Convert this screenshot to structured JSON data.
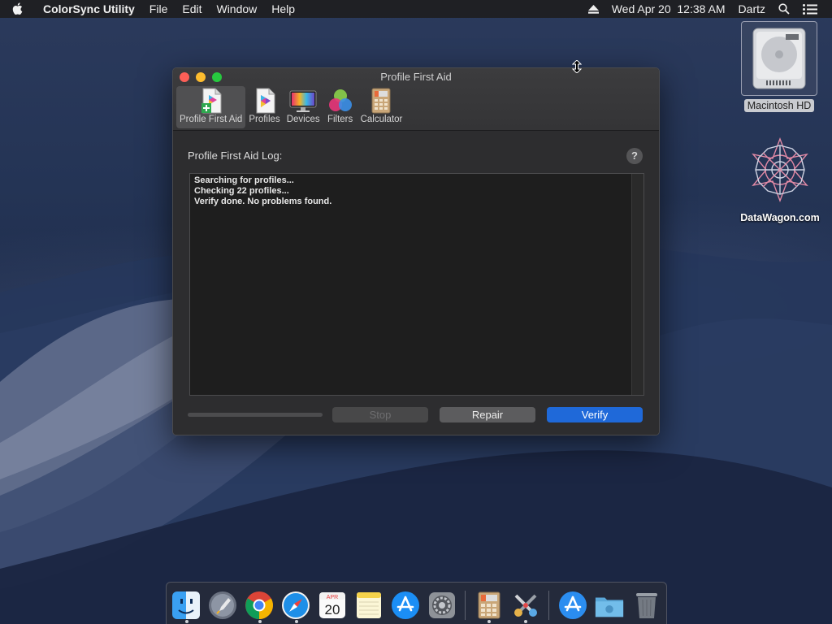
{
  "menubar": {
    "app_name": "ColorSync Utility",
    "menus": [
      "File",
      "Edit",
      "Window",
      "Help"
    ],
    "datetime": "Wed Apr 20  12:38 AM",
    "user": "Dartz"
  },
  "desktop": {
    "icons": [
      {
        "label": "Macintosh HD",
        "icon": "hard-drive-icon"
      },
      {
        "label": "DataWagon.com",
        "icon": "datawagon-logo-icon"
      }
    ]
  },
  "window": {
    "title": "Profile First Aid",
    "toolbar": [
      {
        "label": "Profile First Aid",
        "icon": "first-aid-icon",
        "active": true
      },
      {
        "label": "Profiles",
        "icon": "profiles-icon",
        "active": false
      },
      {
        "label": "Devices",
        "icon": "devices-icon",
        "active": false
      },
      {
        "label": "Filters",
        "icon": "filters-icon",
        "active": false
      },
      {
        "label": "Calculator",
        "icon": "calculator-icon",
        "active": false
      }
    ],
    "log_title": "Profile First Aid Log:",
    "help_label": "?",
    "log_lines": [
      "Searching for profiles...",
      "Checking 22 profiles...",
      "Verify done. No problems found."
    ],
    "buttons": {
      "stop": "Stop",
      "repair": "Repair",
      "verify": "Verify"
    }
  },
  "dock": {
    "apps": [
      {
        "name": "Finder",
        "icon": "finder-icon",
        "running": true
      },
      {
        "name": "Launchpad",
        "icon": "launchpad-icon",
        "running": false
      },
      {
        "name": "Google Chrome",
        "icon": "chrome-icon",
        "running": true
      },
      {
        "name": "Safari",
        "icon": "safari-icon",
        "running": true
      },
      {
        "name": "Calendar",
        "icon": "calendar-icon",
        "running": false,
        "month": "APR",
        "day": "20"
      },
      {
        "name": "Notes",
        "icon": "notes-icon",
        "running": false
      },
      {
        "name": "App Store",
        "icon": "app-store-icon",
        "running": false
      },
      {
        "name": "System Preferences",
        "icon": "system-preferences-icon",
        "running": false
      },
      {
        "name": "ColorSync Utility",
        "icon": "colorsync-icon",
        "running": true
      },
      {
        "name": "Utilities",
        "icon": "utilities-icon",
        "running": true
      },
      {
        "name": "Applications",
        "icon": "applications-folder-icon",
        "running": false
      },
      {
        "name": "Downloads",
        "icon": "downloads-folder-icon",
        "running": false
      },
      {
        "name": "Trash",
        "icon": "trash-icon",
        "running": false
      }
    ]
  },
  "colors": {
    "accent": "#1f69d9",
    "close": "#fc5f57",
    "minimize": "#fdbc2e",
    "maximize": "#27c93f"
  }
}
